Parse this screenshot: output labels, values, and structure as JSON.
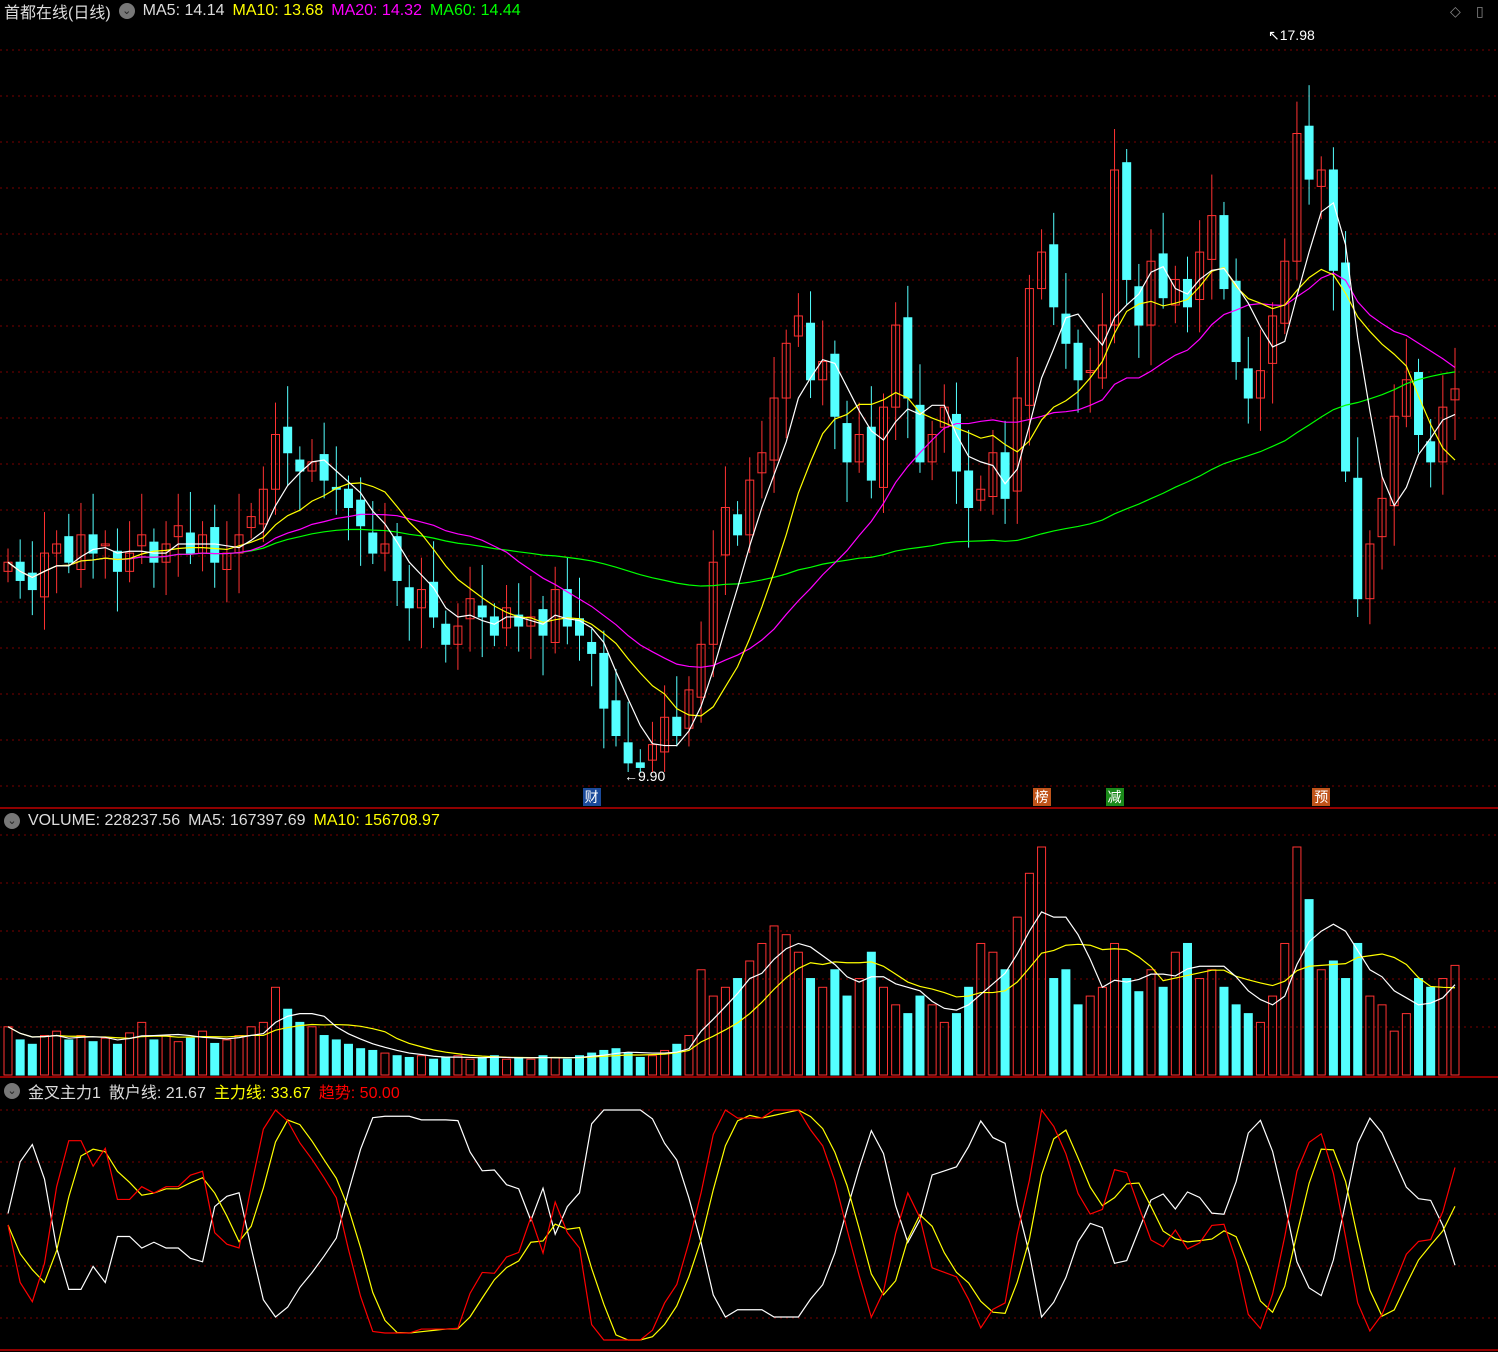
{
  "main": {
    "title": "首都在线(日线)",
    "ma5": "MA5: 14.14",
    "ma10": "MA10: 13.68",
    "ma20": "MA20: 14.32",
    "ma60": "MA60: 14.44",
    "high_label": "17.98",
    "low_label": "9.90"
  },
  "markers": [
    {
      "label": "财",
      "index": 48,
      "color": "#1b4a9a"
    },
    {
      "label": "榜",
      "index": 85,
      "color": "#c0541a"
    },
    {
      "label": "减",
      "index": 91,
      "color": "#1a8a1a"
    },
    {
      "label": "预",
      "index": 108,
      "color": "#c0541a"
    }
  ],
  "volume": {
    "label": "VOLUME: 228237.56",
    "ma5": "MA5: 167397.69",
    "ma10": "MA10: 156708.97"
  },
  "indicator": {
    "name": "金叉主力1",
    "retail": "散户线: 21.67",
    "main": "主力线: 33.67",
    "trend": "趋势: 50.00"
  },
  "colors": {
    "up": "#ff3232",
    "down": "#54ffff",
    "ma5": "#ffffff",
    "ma10": "#ffff00",
    "ma20": "#ff00ff",
    "ma60": "#00ff00"
  },
  "chart_data": {
    "type": "candlestick",
    "price_range": [
      9.9,
      17.98
    ],
    "closes": [
      12.2,
      12.0,
      11.9,
      12.3,
      12.4,
      12.2,
      12.5,
      12.3,
      12.4,
      12.1,
      12.3,
      12.5,
      12.2,
      12.4,
      12.6,
      12.3,
      12.5,
      12.2,
      12.3,
      12.5,
      12.7,
      13.0,
      13.6,
      13.4,
      13.2,
      13.3,
      13.1,
      13.0,
      12.8,
      12.6,
      12.3,
      12.4,
      12.0,
      11.7,
      11.9,
      11.6,
      11.3,
      11.5,
      11.8,
      11.6,
      11.4,
      11.7,
      11.5,
      11.6,
      11.4,
      11.9,
      11.5,
      11.4,
      11.2,
      10.6,
      10.3,
      10.0,
      9.95,
      10.2,
      10.5,
      10.3,
      10.8,
      11.3,
      12.2,
      12.8,
      12.5,
      13.1,
      13.4,
      14.0,
      14.6,
      14.9,
      14.2,
      14.4,
      13.8,
      13.3,
      13.6,
      13.1,
      13.9,
      14.8,
      14.0,
      13.3,
      13.6,
      13.9,
      13.2,
      12.8,
      13.0,
      13.4,
      12.9,
      14.0,
      15.2,
      15.6,
      15.0,
      14.6,
      14.2,
      14.3,
      14.8,
      16.5,
      15.3,
      14.8,
      15.5,
      15.1,
      15.3,
      15.0,
      15.6,
      16.0,
      15.2,
      14.4,
      14.0,
      14.3,
      14.9,
      15.5,
      16.9,
      16.4,
      16.5,
      15.4,
      13.2,
      11.8,
      12.4,
      12.9,
      13.8,
      14.2,
      13.6,
      13.3,
      13.9,
      14.1
    ],
    "volumes_k": [
      55,
      40,
      35,
      45,
      50,
      40,
      45,
      38,
      42,
      35,
      48,
      60,
      40,
      45,
      38,
      42,
      50,
      36,
      40,
      45,
      55,
      60,
      100,
      75,
      60,
      55,
      45,
      40,
      35,
      30,
      28,
      25,
      22,
      20,
      22,
      18,
      20,
      22,
      18,
      20,
      22,
      18,
      20,
      18,
      22,
      20,
      18,
      22,
      25,
      28,
      30,
      25,
      20,
      22,
      28,
      35,
      45,
      120,
      90,
      100,
      110,
      130,
      150,
      170,
      160,
      140,
      110,
      100,
      120,
      90,
      110,
      140,
      100,
      80,
      70,
      90,
      80,
      60,
      70,
      100,
      150,
      140,
      120,
      180,
      230,
      260,
      110,
      120,
      80,
      90,
      100,
      150,
      110,
      95,
      120,
      100,
      140,
      150,
      110,
      120,
      100,
      80,
      70,
      60,
      90,
      150,
      260,
      200,
      120,
      130,
      110,
      150,
      90,
      80,
      50,
      70,
      110,
      100,
      110,
      125
    ],
    "indicator_range": [
      0,
      100
    ]
  }
}
